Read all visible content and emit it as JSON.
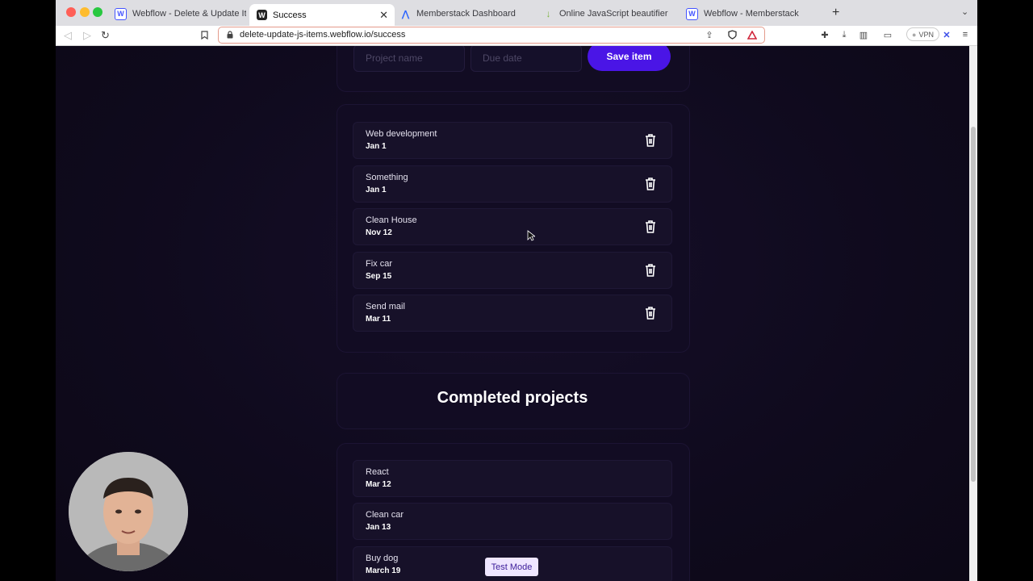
{
  "browser": {
    "tabs": [
      {
        "title": "Webflow - Delete & Update Items",
        "favicon": "webflow-icon"
      },
      {
        "title": "Success",
        "favicon": "webflow-icon",
        "active": true
      },
      {
        "title": "Memberstack Dashboard",
        "favicon": "memberstack-icon"
      },
      {
        "title": "Online JavaScript beautifier",
        "favicon": "beautifier-icon"
      },
      {
        "title": "Webflow - Memberstack",
        "favicon": "webflow-icon"
      }
    ],
    "url": "delete-update-js-items.webflow.io/success",
    "vpn_label": "VPN"
  },
  "form": {
    "project_placeholder": "Project name",
    "date_placeholder": "Due date",
    "save_label": "Save item"
  },
  "active_items": [
    {
      "name": "Web development",
      "date": "Jan 1"
    },
    {
      "name": "Something",
      "date": "Jan 1"
    },
    {
      "name": "Clean House",
      "date": "Nov 12"
    },
    {
      "name": "Fix car",
      "date": "Sep 15"
    },
    {
      "name": "Send mail",
      "date": "Mar 11"
    }
  ],
  "completed": {
    "title": "Completed projects",
    "items": [
      {
        "name": "React",
        "date": "Mar 12"
      },
      {
        "name": "Clean car",
        "date": "Jan 13"
      },
      {
        "name": "Buy dog",
        "date": "March 19"
      }
    ]
  },
  "test_mode_label": "Test Mode",
  "colors": {
    "accent": "#4a15e6",
    "page_bg": "#0f0a1b",
    "card_bg": "#171129"
  }
}
